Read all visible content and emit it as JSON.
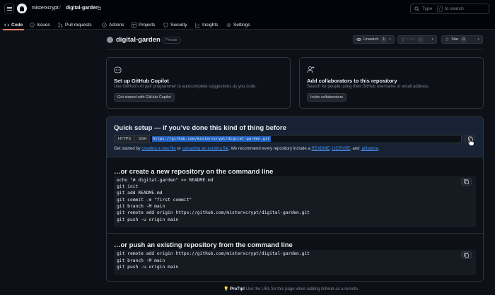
{
  "header": {
    "owner": "misterxcrypt",
    "separator": "/",
    "repo": "digital-garden",
    "search": {
      "type_label": "Type",
      "key": "/",
      "rest": "to search"
    }
  },
  "nav": {
    "tabs": [
      {
        "label": "Code",
        "icon": "code-icon",
        "active": true
      },
      {
        "label": "Issues",
        "icon": "issue-icon"
      },
      {
        "label": "Pull requests",
        "icon": "pull-request-icon"
      },
      {
        "label": "Actions",
        "icon": "play-icon"
      },
      {
        "label": "Projects",
        "icon": "table-icon"
      },
      {
        "label": "Security",
        "icon": "shield-icon"
      },
      {
        "label": "Insights",
        "icon": "graph-icon"
      },
      {
        "label": "Settings",
        "icon": "gear-icon"
      }
    ]
  },
  "repo": {
    "title": "digital-garden",
    "visibility": "Private",
    "unwatch_label": "Unwatch",
    "unwatch_count": "1",
    "fork_label": "Fork",
    "fork_count": "0",
    "star_label": "Star",
    "star_count": "0"
  },
  "cards": {
    "copilot": {
      "title": "Set up GitHub Copilot",
      "desc": "Use GitHub's AI pair programmer to autocomplete suggestions as you code.",
      "button": "Get started with GitHub Copilot"
    },
    "collab": {
      "title": "Add collaborators to this repository",
      "desc": "Search for people using their GitHub username or email address.",
      "button": "Invite collaborators"
    }
  },
  "quick_setup": {
    "title": "Quick setup — if you’ve done this kind of thing before",
    "https": "HTTPS",
    "ssh": "SSH",
    "url": "https://github.com/misterxcrypt/digital-garden.git",
    "line": {
      "prefix": "Get started by ",
      "link1": "creating a new file",
      "mid1": " or ",
      "link2": "uploading an existing file",
      "mid2": ". We recommend every repository include a ",
      "link3": "README",
      "mid3": ", ",
      "link4": "LICENSE",
      "mid4": ", and ",
      "link5": ".gitignore",
      "suffix": "."
    }
  },
  "create_section": {
    "title": "…or create a new repository on the command line",
    "lines": [
      "echo \"# digital-garden\" >> README.md",
      "git init",
      "git add README.md",
      "git commit -m \"first commit\"",
      "git branch -M main",
      "git remote add origin https://github.com/misterxcrypt/digital-garden.git",
      "git push -u origin main"
    ]
  },
  "push_section": {
    "title": "…or push an existing repository from the command line",
    "lines": [
      "git remote add origin https://github.com/misterxcrypt/digital-garden.git",
      "git branch -M main",
      "git push -u origin main"
    ]
  },
  "protip": {
    "bold": "ProTip!",
    "text": " Use the URL for this page when adding GitHub as a remote."
  },
  "colors": {
    "background": "#0d1117",
    "header": "#010409",
    "accent": "#f78166",
    "link": "#4493f8",
    "setup_highlight": "#172235"
  }
}
